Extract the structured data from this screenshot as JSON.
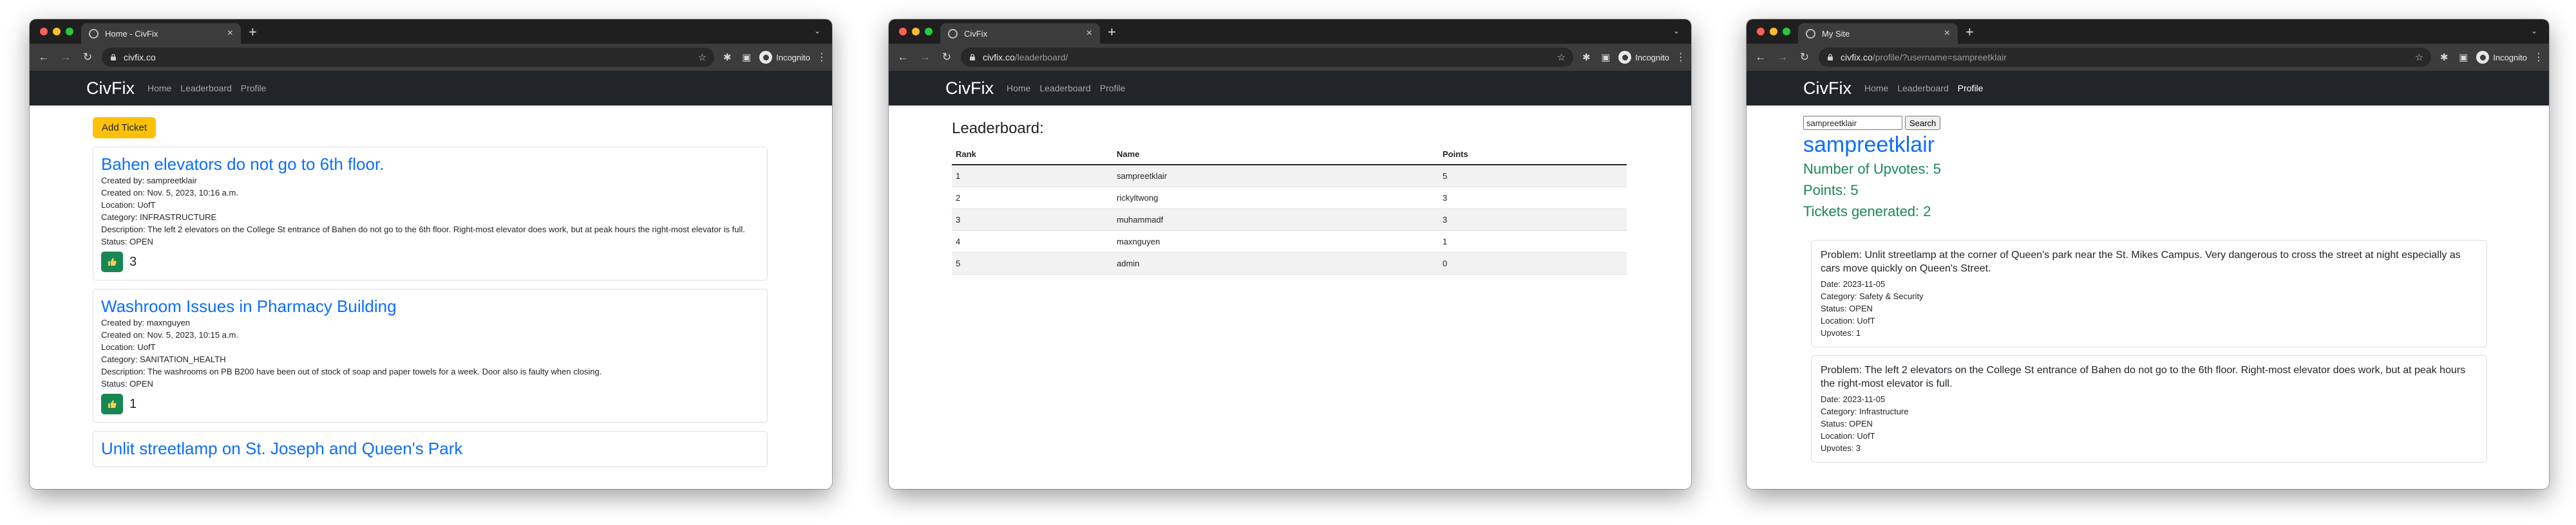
{
  "windows": [
    {
      "tab_title": "Home - CivFix",
      "url_host": "civfix.co",
      "url_path": "",
      "incognito_label": "Incognito",
      "nav": {
        "brand": "CivFix",
        "links": [
          "Home",
          "Leaderboard",
          "Profile"
        ]
      },
      "add_ticket_label": "Add Ticket",
      "tickets": [
        {
          "title": "Bahen elevators do not go to 6th floor.",
          "created_by": "Created by: sampreetklair",
          "created_on": "Created on: Nov. 5, 2023, 10:16 a.m.",
          "location": "Location: UofT",
          "category": "Category: INFRASTRUCTURE",
          "description": "Description: The left 2 elevators on the College St entrance of Bahen do not go to the 6th floor. Right-most elevator does work, but at peak hours the right-most elevator is full.",
          "status": "Status: OPEN",
          "upvotes": "3"
        },
        {
          "title": "Washroom Issues in Pharmacy Building",
          "created_by": "Created by: maxnguyen",
          "created_on": "Created on: Nov. 5, 2023, 10:15 a.m.",
          "location": "Location: UofT",
          "category": "Category: SANITATION_HEALTH",
          "description": "Description: The washrooms on PB B200 have been out of stock of soap and paper towels for a week. Door also is faulty when closing.",
          "status": "Status: OPEN",
          "upvotes": "1"
        },
        {
          "title": "Unlit streetlamp on St. Joseph and Queen's Park"
        }
      ]
    },
    {
      "tab_title": "CivFix",
      "url_host": "civfix.co",
      "url_path": "/leaderboard/",
      "incognito_label": "Incognito",
      "nav": {
        "brand": "CivFix",
        "links": [
          "Home",
          "Leaderboard",
          "Profile"
        ]
      },
      "heading": "Leaderboard:",
      "columns": [
        "Rank",
        "Name",
        "Points"
      ],
      "rows": [
        [
          "1",
          "sampreetklair",
          "5"
        ],
        [
          "2",
          "rickyltwong",
          "3"
        ],
        [
          "3",
          "muhammadf",
          "3"
        ],
        [
          "4",
          "maxnguyen",
          "1"
        ],
        [
          "5",
          "admin",
          "0"
        ]
      ]
    },
    {
      "tab_title": "My Site",
      "url_host": "civfix.co",
      "url_path": "/profile/?username=sampreetklair",
      "incognito_label": "Incognito",
      "nav": {
        "brand": "CivFix",
        "links": [
          "Home",
          "Leaderboard",
          "Profile"
        ]
      },
      "search_value": "sampreetklair",
      "search_button": "Search",
      "username": "sampreetklair",
      "upvotes_stat": "Number of Upvotes: 5",
      "points_stat": "Points: 5",
      "tickets_stat": "Tickets generated: 2",
      "problems": [
        {
          "title": "Problem: Unlit streetlamp at the corner of Queen's park near the St. Mikes Campus. Very dangerous to cross the street at night especially as cars move quickly on Queen's Street.",
          "date": "Date: 2023-11-05",
          "category": "Category: Safety & Security",
          "status": "Status: OPEN",
          "location": "Location: UofT",
          "upvotes": "Upvotes: 1"
        },
        {
          "title": "Problem: The left 2 elevators on the College St entrance of Bahen do not go to the 6th floor. Right-most elevator does work, but at peak hours the right-most elevator is full.",
          "date": "Date: 2023-11-05",
          "category": "Category: Infrastructure",
          "status": "Status: OPEN",
          "location": "Location: UofT",
          "upvotes": "Upvotes: 3"
        }
      ]
    }
  ],
  "colors": {
    "navbar_bg": "#212529",
    "link_blue": "#0d6efd",
    "success_green": "#198754",
    "warning_yellow": "#ffc107",
    "browser_chrome": "#3c3c3c"
  },
  "icons": {
    "upvote": "thumbs-up-icon",
    "lock": "lock-icon",
    "bookmark": "star-icon",
    "extensions": "puzzle-icon",
    "incognito": "incognito-icon"
  }
}
